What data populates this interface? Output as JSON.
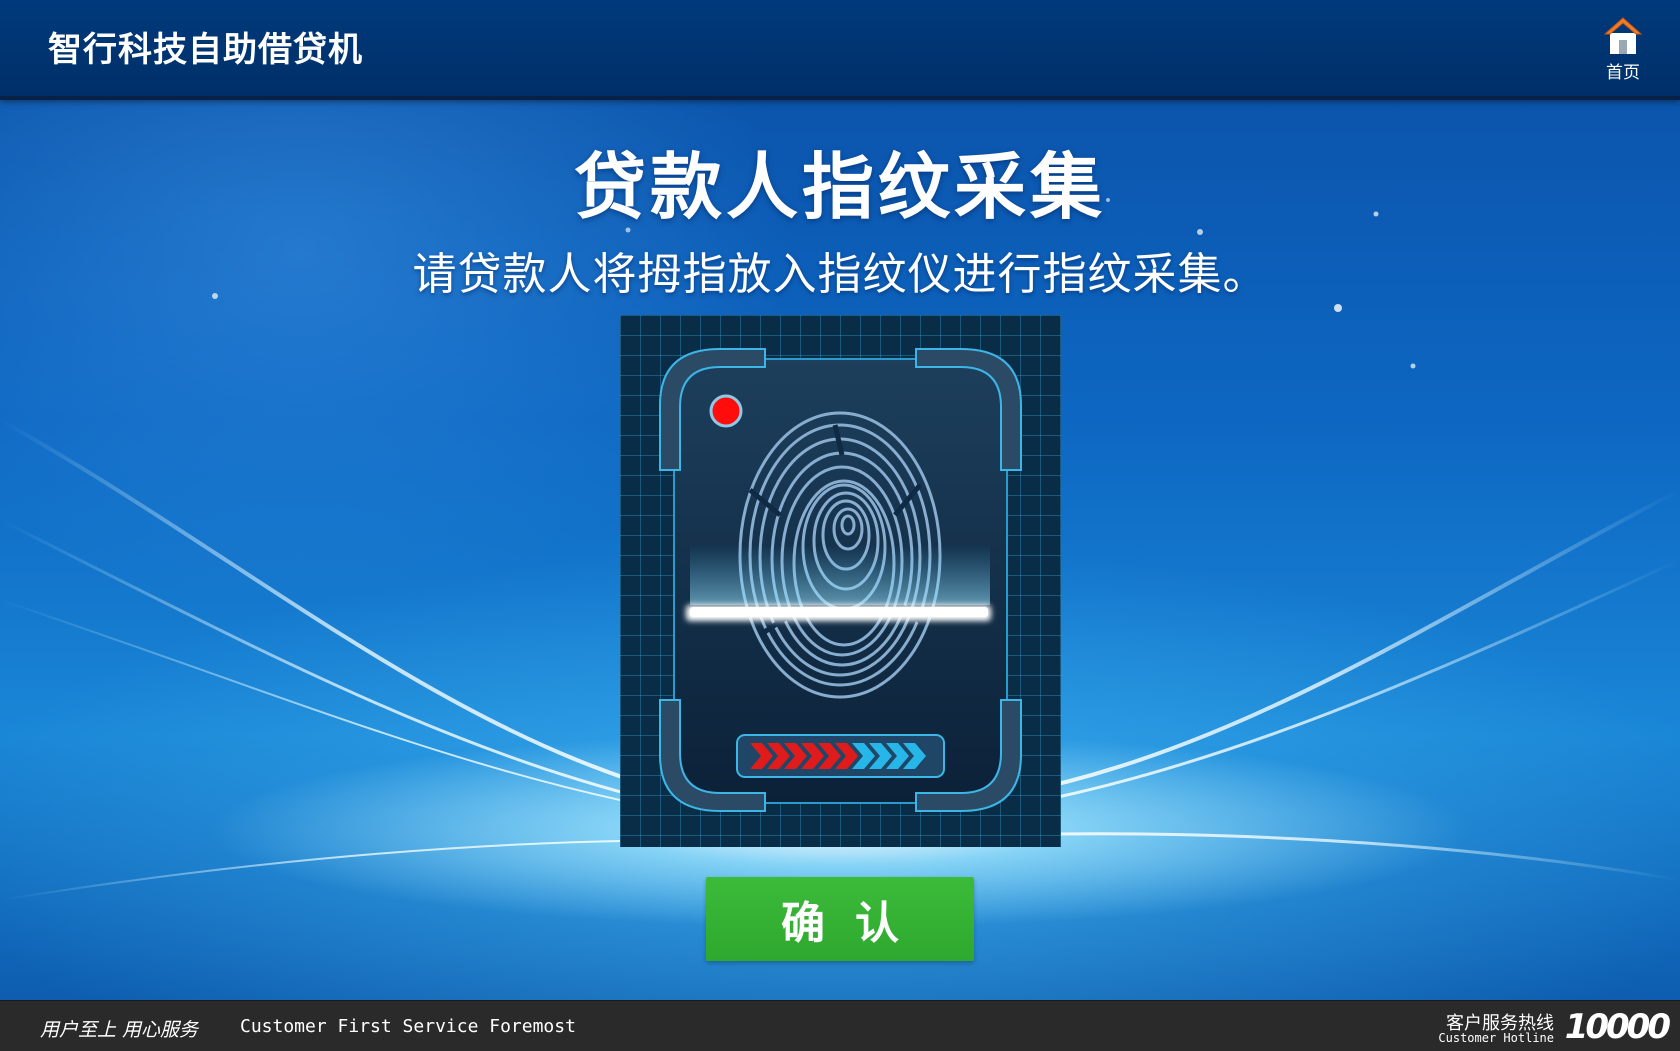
{
  "header": {
    "app_title": "智行科技自助借贷机",
    "home_label": "首页",
    "home_icon": "home-icon"
  },
  "main": {
    "title": "贷款人指纹采集",
    "instruction": "请贷款人将拇指放入指纹仪进行指纹采集。",
    "confirm_label": "确认",
    "scanner_icon": "fingerprint-icon"
  },
  "footer": {
    "slogan_cn": "用户至上 用心服务",
    "slogan_en": "Customer First Service Foremost",
    "hotline_cn": "客户服务热线",
    "hotline_en": "Customer Hotline",
    "hotline_number": "10000"
  },
  "colors": {
    "header_bg": "#003a7c",
    "confirm_green": "#34b234",
    "footer_bg": "#2a2a2a",
    "status_red": "#ff0000",
    "progress_red": "#e01b1b",
    "progress_cyan": "#27b6e8"
  }
}
